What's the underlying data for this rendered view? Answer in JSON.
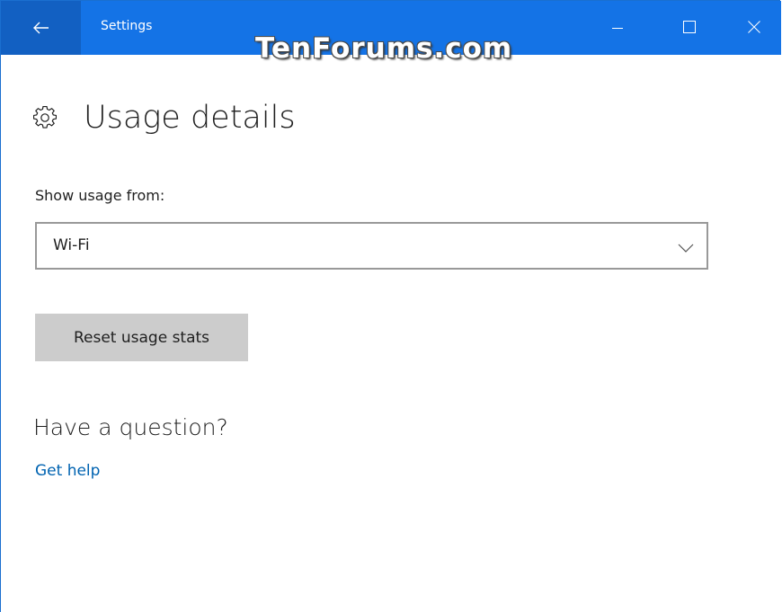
{
  "window": {
    "app_title": "Settings",
    "watermark": "TenForums.com",
    "accent_color": "#1473e6",
    "back_button_color": "#1260c2"
  },
  "titlebar_icons": {
    "back": "back-arrow-icon",
    "minimize": "minimize-icon",
    "maximize": "maximize-icon",
    "close": "close-icon"
  },
  "page": {
    "icon": "gear-icon",
    "title": "Usage details",
    "show_usage_label": "Show usage from:",
    "dropdown_value": "Wi-Fi",
    "reset_button_label": "Reset usage stats",
    "question_heading": "Have a question?",
    "help_link_label": "Get help",
    "link_color": "#0063b1"
  }
}
